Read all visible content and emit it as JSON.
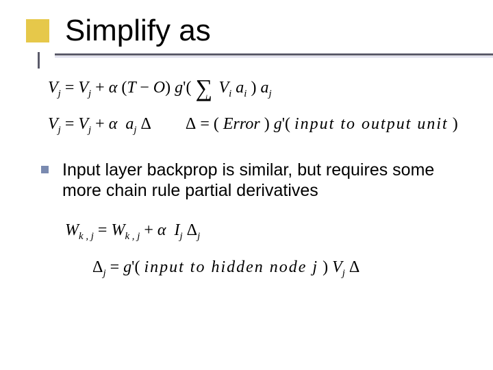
{
  "title": "Simplify as",
  "eq1": {
    "lhs_var": "V",
    "lhs_sub": "j",
    "rhs_term1_var": "V",
    "rhs_term1_sub": "j",
    "plus": "+",
    "alpha": "α",
    "lpar": "(",
    "T": "T",
    "minus": "−",
    "O": "O",
    "rpar": ")",
    "g": "g",
    "prime": "'",
    "sum": "∑",
    "sum_idx": "i",
    "Vi": "V",
    "Vi_sub": "i",
    "ai": "a",
    "ai_sub": "i",
    "aj": "a",
    "aj_sub": "j"
  },
  "eq2a": {
    "lhs_var": "V",
    "lhs_sub": "j",
    "rhs_term1_var": "V",
    "rhs_term1_sub": "j",
    "plus": "+",
    "alpha": "α",
    "a": "a",
    "a_sub": "j",
    "delta": "Δ"
  },
  "eq2b": {
    "delta": "Δ",
    "eq": "=",
    "lpar": "(",
    "error": "Error",
    "rpar": ")",
    "g": "g",
    "prime": "'",
    "text": "input to output unit"
  },
  "bullet": "Input layer backprop is similar, but requires some more chain rule partial derivatives",
  "eq3": {
    "W": "W",
    "sub_kj": "k , j",
    "eq": "=",
    "plus": "+",
    "alpha": "α",
    "I": "I",
    "I_sub": "j",
    "delta": "Δ",
    "delta_sub": "j"
  },
  "eq4": {
    "delta": "Δ",
    "delta_sub": "j",
    "eq": "=",
    "g": "g",
    "prime": "'",
    "lpar": "(",
    "text": "input to hidden node j",
    "rpar": ")",
    "V": "V",
    "V_sub": "j",
    "delta2": "Δ"
  }
}
